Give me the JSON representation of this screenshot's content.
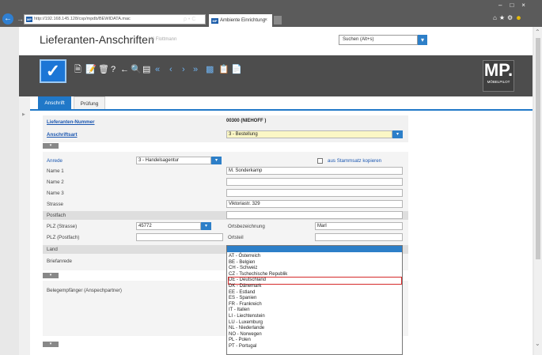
{
  "browser": {
    "url": "http://192.168.145.128/csp/mpdb/BEWIDATA.mac",
    "url_tools": "ρ • C",
    "tab_label": "Ambiente Einrichtung",
    "favicon_text": "MP"
  },
  "header": {
    "title": "Lieferanten-Anschriften",
    "user": "Uli Flottmann",
    "search_placeholder": "Suchen (Alt+s)"
  },
  "toolbar": {
    "logo_text": "MP.",
    "logo_sub": "MÖBELPILOT"
  },
  "tabs": [
    {
      "label": "Anschrift"
    },
    {
      "label": "Prüfung"
    }
  ],
  "form": {
    "lieferanten_nummer_label": "Lieferanten-Nummer",
    "lieferanten_nummer_value": "00300 (NIEHOFF )",
    "anschriftsart_label": "Anschriftsart",
    "anschriftsart_value": "3 - Bestellung",
    "anrede_label": "Anrede",
    "anrede_value": "3 - Handelsagentur",
    "stammsatz_label": "aus Stammsatz kopieren",
    "name1_label": "Name 1",
    "name1_value": "M. Sonderkamp",
    "name2_label": "Name 2",
    "name3_label": "Name 3",
    "strasse_label": "Strasse",
    "strasse_value": "Viktoriastr. 329",
    "postfach_label": "Postfach",
    "plz_strasse_label": "PLZ (Strasse)",
    "plz_strasse_value": "45772",
    "ortsbezeichnung_label": "Ortsbezeichnung",
    "ortsbezeichnung_value": "Marl",
    "plz_postfach_label": "PLZ (Postfach)",
    "ortsteil_label": "Ortsteil",
    "land_label": "Land",
    "briefanrede_label": "Briefanrede",
    "belegempfaenger_label": "Belegempfänger (Anspechpartner)"
  },
  "country_dropdown": {
    "items": [
      "AT - Österreich",
      "BE - Belgien",
      "CH - Schweiz",
      "CZ - Tschechische Republik",
      "DE - Deutschland",
      "DK - Dänemark",
      "EE - Estland",
      "ES - Spanien",
      "FR - Frankreich",
      "IT - Italien",
      "LI - Liechtenstein",
      "LU - Luxemburg",
      "NL - Niederlande",
      "NO - Norwegen",
      "PL - Polen",
      "PT - Portugal"
    ],
    "highlighted": "DE - Deutschland"
  },
  "colors": {
    "accent": "#2078c8",
    "highlight": "#d52a2a",
    "toolbar": "#4d4d4d"
  }
}
